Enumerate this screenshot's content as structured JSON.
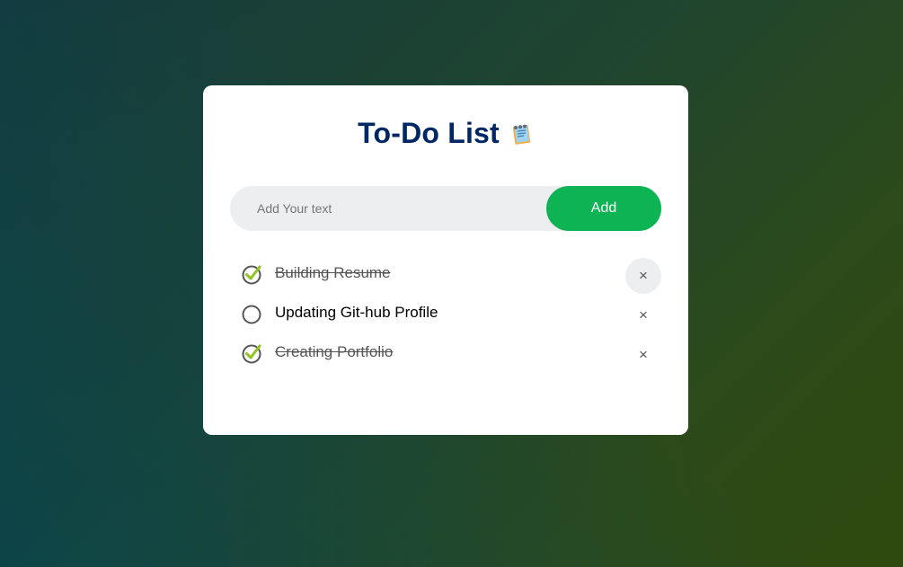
{
  "app": {
    "title": "To-Do List",
    "title_icon": "notepad-icon"
  },
  "input": {
    "placeholder": "Add Your text",
    "value": ""
  },
  "add_button": {
    "label": "Add"
  },
  "tasks": [
    {
      "text": "Building Resume",
      "checked": true,
      "delete_label": "×"
    },
    {
      "text": "Updating Git-hub Profile",
      "checked": false,
      "delete_label": "×"
    },
    {
      "text": "Creating Portfolio",
      "checked": true,
      "delete_label": "×"
    }
  ],
  "colors": {
    "title": "#002765",
    "accent": "#0eb454",
    "check_mark": "#8fc31f",
    "card": "#ffffff",
    "input_bg": "#edeef0"
  }
}
